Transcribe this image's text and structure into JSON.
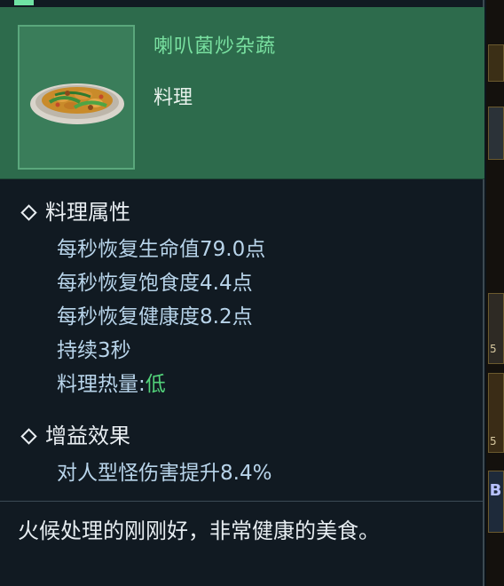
{
  "item": {
    "name": "喇叭菌炒杂蔬",
    "type": "料理",
    "icon": "stir-fried-vegetables-dish-icon"
  },
  "attributes": {
    "title": "料理属性",
    "lines": [
      "每秒恢复生命值79.0点",
      "每秒恢复饱食度4.4点",
      "每秒恢复健康度8.2点",
      "持续3秒"
    ],
    "heat_label": "料理热量:",
    "heat_value": "低"
  },
  "buff": {
    "title": "增益效果",
    "lines": [
      "对人型怪伤害提升8.4%"
    ]
  },
  "description": "火候处理的刚刚好，非常健康的美食。",
  "background": {
    "slot_numbers": [
      "5",
      "5"
    ],
    "badge_glyph": "B"
  },
  "colors": {
    "header_bg": "#2d6b4c",
    "name": "#79e0a0",
    "attr_text": "#b8d4ea",
    "heat_low": "#52d27a"
  }
}
